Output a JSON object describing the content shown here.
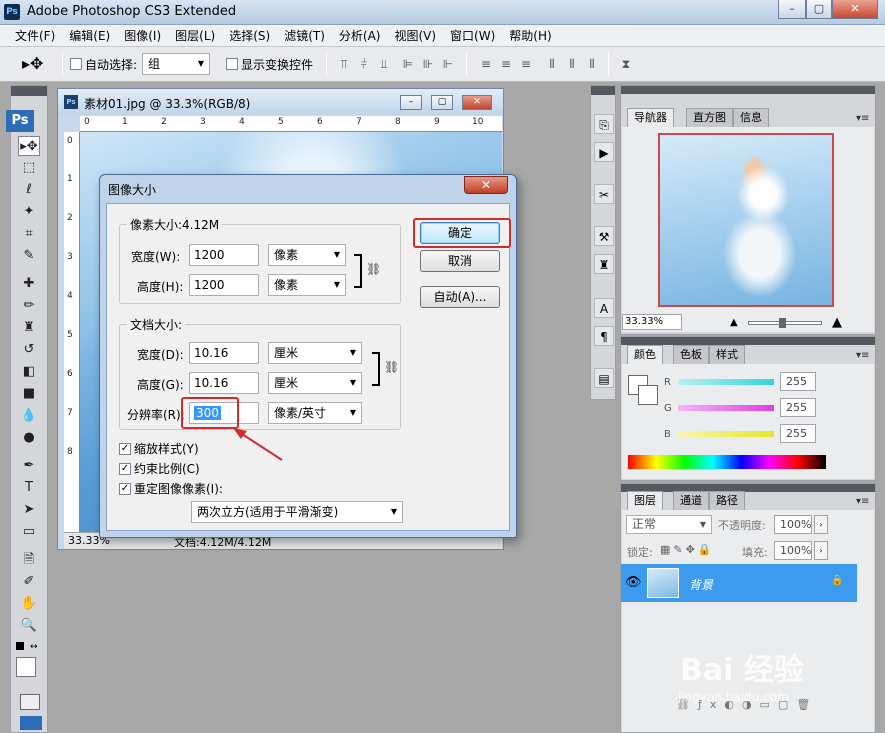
{
  "app": {
    "title": "Adobe Photoshop CS3 Extended",
    "logo": "Ps",
    "window_buttons": [
      "–",
      "▢",
      "✕"
    ]
  },
  "menu": [
    "文件(F)",
    "编辑(E)",
    "图像(I)",
    "图层(L)",
    "选择(S)",
    "滤镜(T)",
    "分析(A)",
    "视图(V)",
    "窗口(W)",
    "帮助(H)"
  ],
  "options_bar": {
    "auto_select_label": "自动选择:",
    "auto_select_value": "组",
    "show_transform_label": "显示变换控件"
  },
  "tools_badge": "Ps",
  "document": {
    "title": "素材01.jpg @ 33.3%(RGB/8)",
    "ruler_top": [
      "0",
      "1",
      "2",
      "3",
      "4",
      "5",
      "6",
      "7",
      "8",
      "9",
      "10"
    ],
    "ruler_left": [
      "0",
      "1",
      "2",
      "3",
      "4",
      "5",
      "6",
      "7",
      "8"
    ],
    "zoom": "33.33%",
    "doc_info": "文档:4.12M/4.12M"
  },
  "dialog": {
    "title": "图像大小",
    "close": "✕",
    "pixel_group_title": "像素大小:4.12M",
    "pixel_width_label": "宽度(W):",
    "pixel_width_value": "1200",
    "pixel_width_unit": "像素",
    "pixel_height_label": "高度(H):",
    "pixel_height_value": "1200",
    "pixel_height_unit": "像素",
    "doc_group_title": "文档大小:",
    "doc_width_label": "宽度(D):",
    "doc_width_value": "10.16",
    "doc_width_unit": "厘米",
    "doc_height_label": "高度(G):",
    "doc_height_value": "10.16",
    "doc_height_unit": "厘米",
    "resolution_label": "分辨率(R):",
    "resolution_value": "300",
    "resolution_unit": "像素/英寸",
    "ok": "确定",
    "cancel": "取消",
    "auto": "自动(A)...",
    "scale_styles": "缩放样式(Y)",
    "constrain": "约束比例(C)",
    "resample": "重定图像像素(I):",
    "resample_method": "两次立方(适用于平滑渐变)",
    "accent_color": "#d12c2c"
  },
  "navigator_panel": {
    "tabs": [
      "导航器",
      "直方图",
      "信息"
    ],
    "zoom": "33.33%"
  },
  "color_panel": {
    "tabs": [
      "颜色",
      "色板",
      "样式"
    ],
    "channels": [
      {
        "name": "R",
        "value": "255",
        "color": "#33d6d6"
      },
      {
        "name": "G",
        "value": "255",
        "color": "#e040e0"
      },
      {
        "name": "B",
        "value": "255",
        "color": "#e6e62a"
      }
    ]
  },
  "layers_panel": {
    "tabs": [
      "图层",
      "通道",
      "路径"
    ],
    "blend_mode": "正常",
    "opacity_label": "不透明度:",
    "opacity_value": "100%",
    "lock_label": "锁定:",
    "fill_label": "填充:",
    "fill_value": "100%",
    "layer_name": "背景",
    "selected_color": "#3c9bef"
  },
  "watermark": {
    "text": "Bai  经验",
    "sub": "jingyan.baidu.com"
  }
}
